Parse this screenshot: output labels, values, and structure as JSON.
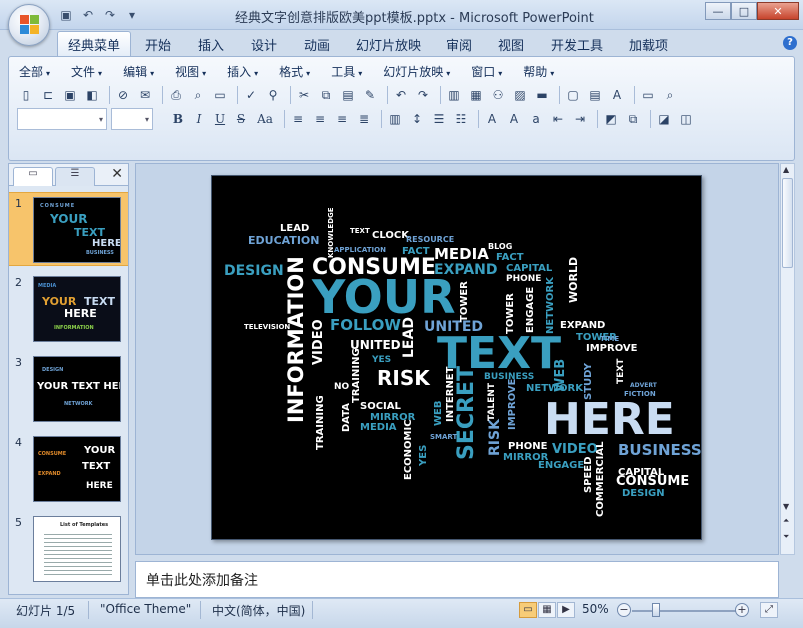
{
  "window": {
    "title": "经典文字创意排版欧美ppt模板.pptx - Microsoft PowerPoint",
    "buttons": {
      "minimize": "—",
      "maximize": "□",
      "close": "✕"
    }
  },
  "tabs": [
    "经典菜单",
    "开始",
    "插入",
    "设计",
    "动画",
    "幻灯片放映",
    "审阅",
    "视图",
    "开发工具",
    "加载项"
  ],
  "menus": [
    "全部",
    "文件",
    "编辑",
    "视图",
    "插入",
    "格式",
    "工具",
    "幻灯片放映",
    "窗口",
    "帮助"
  ],
  "format": {
    "bold": "B",
    "italic": "I",
    "underline": "U",
    "strike": "S",
    "case": "Aa"
  },
  "panel": {
    "slide_numbers": [
      "1",
      "2",
      "3",
      "4",
      "5"
    ],
    "close": "✕"
  },
  "thumb_texts": {
    "t1_your": "YOUR",
    "t1_text": "TEXT",
    "t1_here": "HERE",
    "t2_your": "YOUR",
    "t2_text": "TEXT",
    "t2_here": "HERE",
    "t3_line": "YOUR TEXT HERE",
    "t4_your": "YOUR",
    "t4_text": "TEXT",
    "t4_here": "HERE",
    "t5_title": "List of Templates"
  },
  "slide_words": {
    "your": "YOUR",
    "text": "TEXT",
    "here": "HERE",
    "information": "INFORMATION",
    "consume": "CONSUME",
    "consume2": "CONSUME",
    "media": "MEDIA",
    "expand": "EXPAND",
    "design": "DESIGN",
    "design2": "DESIGN",
    "follow": "FOLLOW",
    "united": "UNITED",
    "united2": "UNITED",
    "risk": "RISK",
    "secret": "SECRET",
    "business": "BUSINESS",
    "business2": "BUSINESS",
    "video": "VIDEO",
    "video2": "VIDEO",
    "capital": "CAPITAL",
    "capital2": "CAPITAL",
    "education": "EDUCATION",
    "lead": "LEAD",
    "lead2": "LEAD",
    "clock": "CLOCK",
    "resource": "RESOURCE",
    "blog": "BLOG",
    "fact": "FACT",
    "fact2": "FACT",
    "phone": "PHONE",
    "phone2": "PHONE",
    "world": "WORLD",
    "network": "NETWORK",
    "network2": "NETWORK",
    "tower": "TOWER",
    "tower2": "TOWER",
    "improve": "IMPROVE",
    "expand2": "EXPAND",
    "training": "TRAINING",
    "training2": "TRAINING",
    "social": "SOCIAL",
    "mirror": "MIRROR",
    "mirror2": "MIRROR",
    "media2": "MEDIA",
    "engage": "ENGAGE",
    "engage2": "ENGAGE",
    "economic": "ECONOMIC",
    "commercial": "COMMERCIAL",
    "speed": "SPEED",
    "television": "TELEVISION",
    "web": "WEB",
    "yes": "YES",
    "no": "NO",
    "data": "DATA",
    "internet": "INTERNET",
    "study": "STUDY",
    "fiction": "FICTION",
    "talent": "TALENT",
    "smart": "SMART",
    "advert": "ADVERT",
    "time": "TIME",
    "application": "APPLICATION",
    "knowledge": "KNOWLEDGE",
    "text_small": "TEXT",
    "risk2": "RISK",
    "improve2": "IMPROVE"
  },
  "notes": {
    "placeholder": "单击此处添加备注"
  },
  "status": {
    "slide": "幻灯片 1/5",
    "theme": "\"Office Theme\"",
    "language": "中文(简体，中国)",
    "zoom": "50%",
    "zoom_out": "−",
    "zoom_in": "+"
  },
  "colors": {
    "accent_teal": "#3a9fc0",
    "light_blue": "#c9dcf2",
    "white": "#ffffff",
    "mid_blue": "#6fa3d6"
  }
}
